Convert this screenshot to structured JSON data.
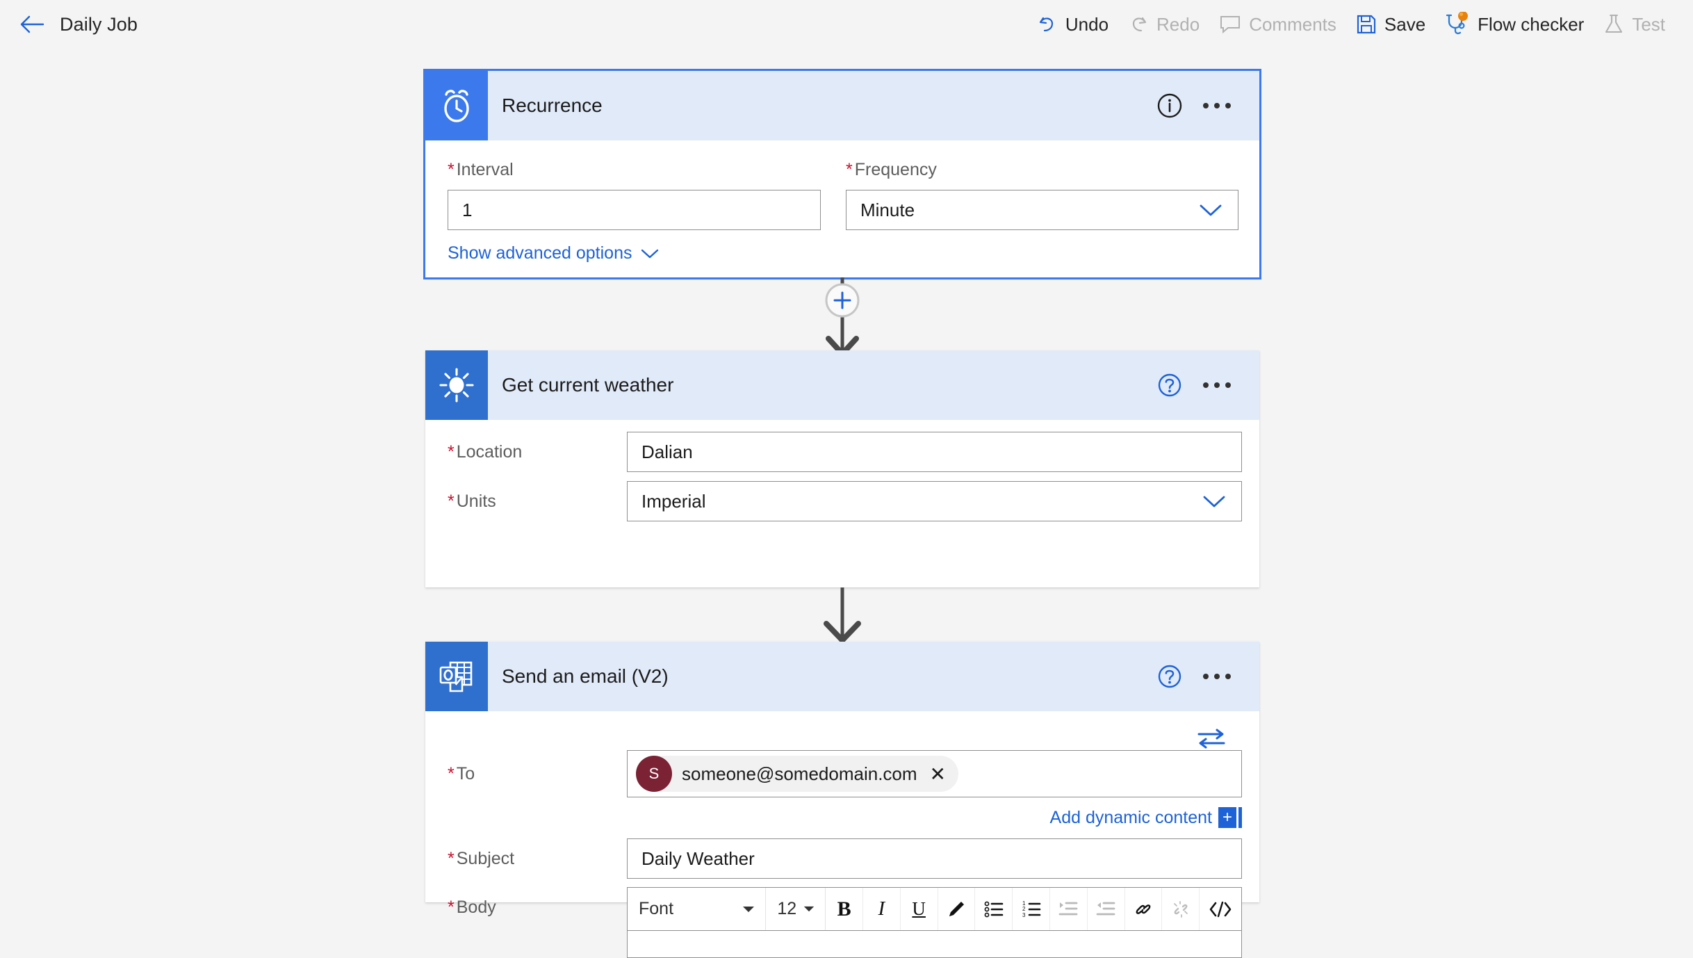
{
  "topbar": {
    "back_icon": "arrow-left-icon",
    "title": "Daily Job",
    "tools": [
      {
        "label": "Undo",
        "icon": "undo-icon",
        "enabled": true
      },
      {
        "label": "Redo",
        "icon": "redo-icon",
        "enabled": false
      },
      {
        "label": "Comments",
        "icon": "comment-icon",
        "enabled": false
      },
      {
        "label": "Save",
        "icon": "save-icon",
        "enabled": true
      },
      {
        "label": "Flow checker",
        "icon": "stethoscope-icon",
        "enabled": true
      },
      {
        "label": "Test",
        "icon": "flask-icon",
        "enabled": false
      }
    ]
  },
  "colors": {
    "accent_blue": "#3b79ed",
    "link_blue": "#1d62d6",
    "header_fill": "#e1eaf9",
    "icon_tile": "#2f6fce",
    "required_red": "#c8102e",
    "avatar_maroon": "#7b2235",
    "badge_orange": "#e8820c",
    "canvas_bg": "#f4f4f4"
  },
  "steps": [
    {
      "id": "recurrence",
      "title": "Recurrence",
      "icon": "alarm-clock-icon",
      "selected": true,
      "header_buttons": [
        {
          "name": "info-icon",
          "glyph": "i"
        },
        {
          "name": "more-options-icon",
          "glyph": "..."
        }
      ],
      "fields": [
        {
          "name": "interval",
          "label": "Interval",
          "required": true,
          "value": "1",
          "type": "text"
        },
        {
          "name": "frequency",
          "label": "Frequency",
          "required": true,
          "value": "Minute",
          "type": "dropdown"
        }
      ],
      "advanced_link": "Show advanced options"
    },
    {
      "id": "get-current-weather",
      "title": "Get current weather",
      "icon": "sun-icon",
      "selected": false,
      "header_buttons": [
        {
          "name": "help-icon",
          "glyph": "?"
        },
        {
          "name": "more-options-icon",
          "glyph": "..."
        }
      ],
      "fields": [
        {
          "name": "location",
          "label": "Location",
          "required": true,
          "value": "Dalian",
          "type": "text"
        },
        {
          "name": "units",
          "label": "Units",
          "required": true,
          "value": "Imperial",
          "type": "dropdown"
        }
      ]
    },
    {
      "id": "send-an-email-v2",
      "title": "Send an email (V2)",
      "icon": "outlook-icon",
      "selected": false,
      "header_buttons": [
        {
          "name": "help-icon",
          "glyph": "?"
        },
        {
          "name": "more-options-icon",
          "glyph": "..."
        }
      ],
      "swap_icon": "swap-arrows-icon",
      "to_field": {
        "label": "To",
        "required": true,
        "recipient": "someone@somedomain.com",
        "avatar_initial": "S",
        "remove_icon": "close-icon"
      },
      "add_dynamic_content": "Add dynamic content",
      "subject_field": {
        "label": "Subject",
        "required": true,
        "value": "Daily Weather"
      },
      "body_field": {
        "label": "Body",
        "required": true,
        "font_select": "Font",
        "size_select": "12",
        "buttons": [
          {
            "name": "bold-icon",
            "label": "B",
            "enabled": true
          },
          {
            "name": "italic-icon",
            "label": "I",
            "enabled": true
          },
          {
            "name": "underline-icon",
            "label": "U",
            "enabled": true
          },
          {
            "name": "highlighter-pen-icon",
            "label": "",
            "enabled": true
          },
          {
            "name": "bulleted-list-icon",
            "label": "",
            "enabled": true
          },
          {
            "name": "numbered-list-icon",
            "label": "",
            "enabled": true
          },
          {
            "name": "indent-increase-icon",
            "label": "",
            "enabled": false
          },
          {
            "name": "indent-decrease-icon",
            "label": "",
            "enabled": false
          },
          {
            "name": "link-icon",
            "label": "",
            "enabled": true
          },
          {
            "name": "unlink-icon",
            "label": "",
            "enabled": false
          },
          {
            "name": "code-view-icon",
            "label": "",
            "enabled": true
          }
        ]
      }
    }
  ],
  "connectors": [
    {
      "name": "add-step-between-recurrence-and-weather",
      "has_plus": true,
      "plus_glyph": "+"
    },
    {
      "name": "connector-weather-to-email",
      "has_plus": false
    }
  ]
}
